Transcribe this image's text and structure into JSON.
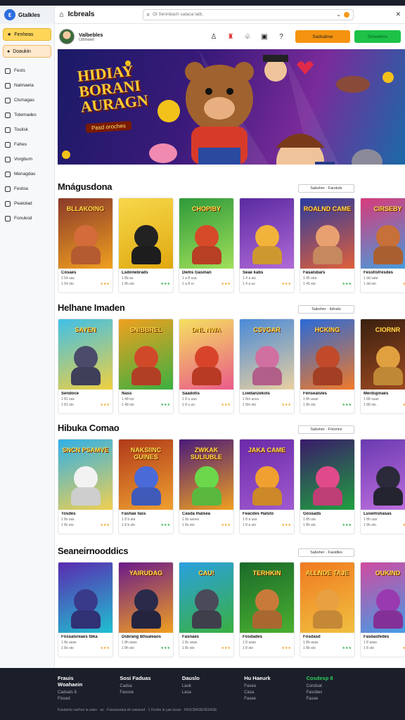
{
  "app": {
    "name": "Gtalkles",
    "title": "Icbreals"
  },
  "search": {
    "placeholder": "Ol Sennbach salaca laib."
  },
  "sidebar": {
    "btn1": "Fenheas",
    "btn2": "Doaukin",
    "items": [
      "Fests",
      "Nalmaeta",
      "Clsmagas",
      "Totemades",
      "Toulisk",
      "Fahes",
      "Vorgbum",
      "Menagdas",
      "Festoa",
      "Peatolad",
      "Fonukod"
    ]
  },
  "user": {
    "name": "Valbebles",
    "sub": "Ultmeeri"
  },
  "header": {
    "btn_orange": "Sadsabse",
    "btn_green": "Smeekins"
  },
  "hero": {
    "title": "HIDIAY BORANI AURAGN",
    "subtitle": "Pasd oroches"
  },
  "sections": [
    {
      "title": "Mnágusdona",
      "see_all": "Sabsher · Farstule",
      "cards": [
        {
          "title": "Cosaes",
          "sub": "1 54 sas",
          "line": "1 54 sto",
          "thumb": "BLLAKOING",
          "c1": "#8b3a2a",
          "c2": "#f0a020",
          "char": "#d46b3a"
        },
        {
          "title": "Lsdonebrads",
          "sub": "1 8b as",
          "line": "1 8h sto",
          "thumb": "",
          "c1": "#f7d84a",
          "c2": "#e0a810",
          "char": "#222222"
        },
        {
          "title": "Dems Gasinan",
          "sub": "1 a 8 sua",
          "line": "1 a 8 ro",
          "thumb": "CHOPIBY",
          "c1": "#2f9a3a",
          "c2": "#9fe05a",
          "char": "#d64a2a"
        },
        {
          "title": "Seae kabs",
          "sub": "1 4 a atc",
          "line": "1 4 a us",
          "thumb": "",
          "c1": "#5a2aa0",
          "c2": "#b06ad8",
          "char": "#f2b33a"
        },
        {
          "title": "Fasalsbars",
          "sub": "1 45 stra",
          "line": "1 45 sto",
          "thumb": "ROALND CAME",
          "c1": "#2a3aa0",
          "c2": "#e0603a",
          "char": "#e8a070"
        },
        {
          "title": "Fessfisfresdes",
          "sub": "1 dd sate",
          "line": "1 dd sto",
          "thumb": "CIRSEBY",
          "c1": "#d83a7a",
          "c2": "#40a0e0",
          "char": "#c8703a"
        }
      ]
    },
    {
      "title": "Helhane Imaden",
      "see_all": "Sabsher · Iidnalo",
      "cards": [
        {
          "title": "Sendoce",
          "sub": "1 81 sas",
          "line": "1 81 sto",
          "thumb": "SAYEN",
          "c1": "#40c0e8",
          "c2": "#f0d040",
          "char": "#4a4a6a"
        },
        {
          "title": "Nass",
          "sub": "1 48 iso",
          "line": "1 48 sto",
          "thumb": "SNIBBREL",
          "c1": "#f0a020",
          "c2": "#3ab040",
          "char": "#d04a2a"
        },
        {
          "title": "Saadotis",
          "sub": "1 8 u uas",
          "line": "1 8 u uo",
          "thumb": "DNL NWA",
          "c1": "#f4e060",
          "c2": "#ea5a8a",
          "char": "#d8442a"
        },
        {
          "title": "Liwdanzekols",
          "sub": "1 8m asus",
          "line": "1 8m sto",
          "thumb": "CSVGAR",
          "c1": "#4a8ad8",
          "c2": "#e8d0a0",
          "char": "#d070a0"
        },
        {
          "title": "Fensealsles",
          "sub": "1 8h asas",
          "line": "1 8h sto",
          "thumb": "HCKING",
          "c1": "#2a6ad8",
          "c2": "#f07a2a",
          "char": "#c04a2a"
        },
        {
          "title": "Merdupnaes",
          "sub": "1 88 suas",
          "line": "1 88 sto",
          "thumb": "CIORNR",
          "c1": "#3a2010",
          "c2": "#a04a20",
          "char": "#e0a040"
        }
      ]
    },
    {
      "title": "Hibuka Comao",
      "see_all": "Sabsher · Fotorins",
      "cards": [
        {
          "title": "Tosdes",
          "sub": "1 8s sas",
          "line": "1 8s sto",
          "thumb": "SNCN PSAMVE",
          "c1": "#30b0e8",
          "c2": "#f0d050",
          "char": "#f2f2f2"
        },
        {
          "title": "Fashae fass",
          "sub": "1 8 b ata",
          "line": "1 8 b sto",
          "thumb": "NAKSIINC GUINES",
          "c1": "#b03a1a",
          "c2": "#f0a030",
          "char": "#4a6ad8"
        },
        {
          "title": "Casda Ihalsea",
          "sub": "1 8s asoes",
          "line": "1 8s sto",
          "thumb": "ZWKAK SULIUBLE",
          "c1": "#4a1a7a",
          "c2": "#f0a020",
          "char": "#6ad84a"
        },
        {
          "title": "Feacdes Halsto",
          "sub": "1 8 a uas",
          "line": "1 8 a sto",
          "thumb": "JAKA CAME",
          "c1": "#6a2aa8",
          "c2": "#a05ad0",
          "char": "#f0a030"
        },
        {
          "title": "Gossads",
          "sub": "1 8h uia",
          "line": "1 8h sto",
          "thumb": "",
          "c1": "#3a1a6a",
          "c2": "#20a040",
          "char": "#e04a8a"
        },
        {
          "title": "Lusemshasas",
          "sub": "1 8h uas",
          "line": "1 8h sto",
          "thumb": "",
          "c1": "#6a3ab0",
          "c2": "#c070e0",
          "char": "#2a2a3a"
        }
      ]
    },
    {
      "title": "Seaneirnooddics",
      "see_all": "Sabsher · Fasidles",
      "cards": [
        {
          "title": "Fossalsniaes tbka",
          "sub": "1 8e asas",
          "line": "1 8e sto",
          "thumb": "",
          "c1": "#5a2ab0",
          "c2": "#20c0d0",
          "char": "#3a3a8a"
        },
        {
          "title": "Dsbrang Bhsaleaos",
          "sub": "1 8h asas",
          "line": "1 8h sto",
          "thumb": "YAIRUDAG",
          "c1": "#6a1a8a",
          "c2": "#f0a020",
          "char": "#2a2a4a"
        },
        {
          "title": "Fasnaes",
          "sub": "1 8c asas",
          "line": "1 8c sto",
          "thumb": "CAU!",
          "c1": "#2aa0e0",
          "c2": "#3ab040",
          "char": "#4a4a5a"
        },
        {
          "title": "Fosdades",
          "sub": "1 8 asas",
          "line": "1 8 sto",
          "thumb": "TERHKIN",
          "c1": "#1a6a2a",
          "c2": "#4ab030",
          "char": "#c87a3a"
        },
        {
          "title": "Fosdasd",
          "sub": "1 8b asas",
          "line": "1 8b sto",
          "thumb": "ALLNDE TAJE",
          "c1": "#f07a20",
          "c2": "#f0c040",
          "char": "#e8a040"
        },
        {
          "title": "Fasbasfedes",
          "sub": "1 8 asas",
          "line": "1 8 sto",
          "thumb": "OUKIND",
          "c1": "#d04aa0",
          "c2": "#40a0e8",
          "char": "#9a3ab0"
        }
      ]
    }
  ],
  "footer": {
    "cols": [
      {
        "h": "Frauis Woahaein",
        "links": [
          "Cadsats 8",
          "Fissed"
        ]
      },
      {
        "h": "Sosi Faduas",
        "links": [
          "Cadsa",
          "Fasose"
        ]
      },
      {
        "h": "Dauslo",
        "links": [
          "Lauk",
          "Lasa"
        ]
      },
      {
        "h": "Hu Haeurk",
        "links": [
          "Fasea",
          "Casa",
          "Fasee"
        ]
      },
      {
        "h": "Cosdesp 8",
        "links": [
          "Condsat",
          "Fassbes",
          "Fasoe"
        ]
      }
    ],
    "note": "Kasdanla sashoe la ades · as · Fassacadua de sakasad · 1 Dosbe la yae lasae · FASCBASEDESASE"
  },
  "colors": {
    "accent_orange": "#f5930f",
    "accent_green": "#1ec247",
    "footer_bg": "#1b1f2a"
  }
}
